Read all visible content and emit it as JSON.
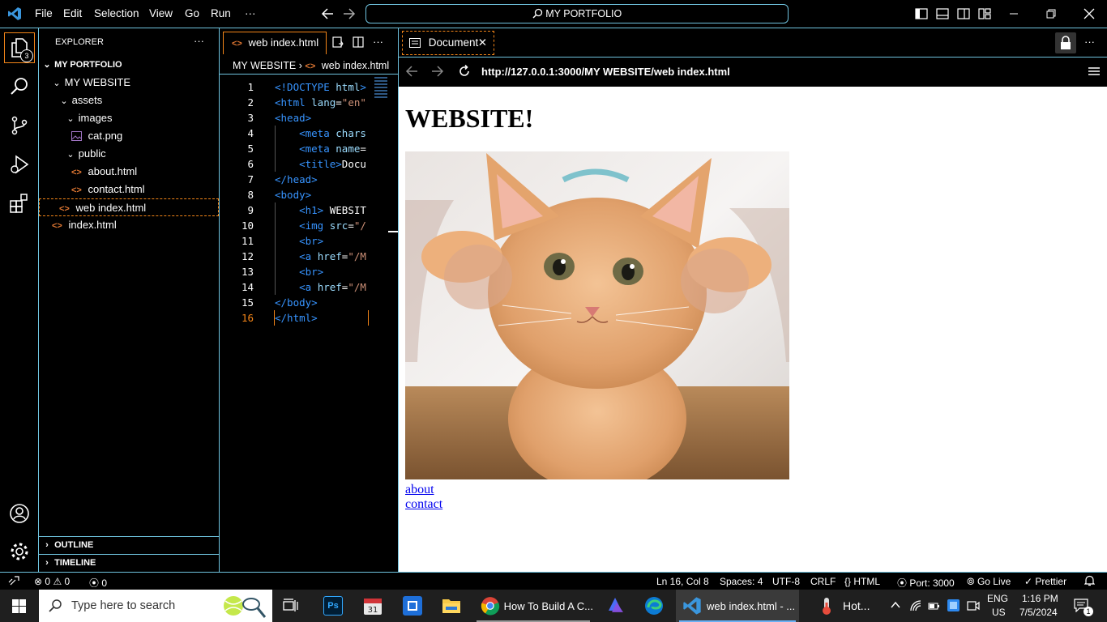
{
  "titlebar": {
    "menu": [
      "File",
      "Edit",
      "Selection",
      "View",
      "Go",
      "Run",
      "···"
    ],
    "command_center": "MY PORTFOLIO"
  },
  "activity": {
    "explorer_badge": "3"
  },
  "explorer": {
    "title": "EXPLORER",
    "more": "···",
    "root": "MY PORTFOLIO",
    "tree": [
      {
        "label": "MY WEBSITE",
        "type": "folder"
      },
      {
        "label": "assets",
        "type": "folder"
      },
      {
        "label": "images",
        "type": "folder"
      },
      {
        "label": "cat.png",
        "type": "image"
      },
      {
        "label": "public",
        "type": "folder"
      },
      {
        "label": "about.html",
        "type": "html"
      },
      {
        "label": "contact.html",
        "type": "html"
      },
      {
        "label": "web index.html",
        "type": "html"
      },
      {
        "label": "index.html",
        "type": "html"
      }
    ],
    "outline": "OUTLINE",
    "timeline": "TIMELINE"
  },
  "editor": {
    "tab_label": "web index.html",
    "more": "···",
    "breadcrumb": [
      "MY WEBSITE",
      "web index.html"
    ],
    "line_numbers": [
      "1",
      "2",
      "3",
      "4",
      "5",
      "6",
      "7",
      "8",
      "9",
      "10",
      "11",
      "12",
      "13",
      "14",
      "15",
      "16"
    ],
    "lines": [
      [
        [
          "tag",
          "<!DOCTYPE "
        ],
        [
          "attr",
          "html"
        ],
        [
          "tag",
          ">"
        ]
      ],
      [
        [
          "tag",
          "<html "
        ],
        [
          "attr",
          "lang"
        ],
        [
          "txtc",
          "="
        ],
        [
          "str",
          "\"en\""
        ]
      ],
      [
        [
          "tag",
          "<head>"
        ]
      ],
      [
        [
          "txtc",
          "    "
        ],
        [
          "tag",
          "<meta "
        ],
        [
          "attr",
          "chars"
        ]
      ],
      [
        [
          "txtc",
          "    "
        ],
        [
          "tag",
          "<meta "
        ],
        [
          "attr",
          "name"
        ],
        [
          "txtc",
          "="
        ]
      ],
      [
        [
          "txtc",
          "    "
        ],
        [
          "tag",
          "<title>"
        ],
        [
          "txtc",
          "Docu"
        ]
      ],
      [
        [
          "tag",
          "</head>"
        ]
      ],
      [
        [
          "tag",
          "<body>"
        ]
      ],
      [
        [
          "txtc",
          "    "
        ],
        [
          "tag",
          "<h1>"
        ],
        [
          "txtc",
          " WEBSIT"
        ]
      ],
      [
        [
          "txtc",
          "    "
        ],
        [
          "tag",
          "<img "
        ],
        [
          "attr",
          "src"
        ],
        [
          "txtc",
          "="
        ],
        [
          "str",
          "\"/"
        ]
      ],
      [
        [
          "txtc",
          "    "
        ],
        [
          "tag",
          "<br>"
        ]
      ],
      [
        [
          "txtc",
          "    "
        ],
        [
          "tag",
          "<a "
        ],
        [
          "attr",
          "href"
        ],
        [
          "txtc",
          "="
        ],
        [
          "str",
          "\"/M"
        ]
      ],
      [
        [
          "txtc",
          "    "
        ],
        [
          "tag",
          "<br>"
        ]
      ],
      [
        [
          "txtc",
          "    "
        ],
        [
          "tag",
          "<a "
        ],
        [
          "attr",
          "href"
        ],
        [
          "txtc",
          "="
        ],
        [
          "str",
          "\"/M"
        ]
      ],
      [
        [
          "tag",
          "</body>"
        ]
      ],
      [
        [
          "tag",
          "</html>"
        ]
      ]
    ]
  },
  "preview": {
    "tab_label": "Document",
    "url": "http://127.0.0.1:3000/MY WEBSITE/web index.html",
    "heading": "WEBSITE!",
    "links": [
      "about",
      "contact"
    ]
  },
  "statusbar": {
    "errors": "0",
    "warnings": "0",
    "ports": "0",
    "position": "Ln 16, Col 8",
    "spaces": "Spaces: 4",
    "encoding": "UTF-8",
    "eol": "CRLF",
    "language": "HTML",
    "port": "Port: 3000",
    "golive": "Go Live",
    "prettier": "Prettier"
  },
  "taskbar": {
    "search_placeholder": "Type here to search",
    "chrome_label": "How To Build A C...",
    "vscode_label": "web index.html - ...",
    "weather": "Hot...",
    "lang1": "ENG",
    "lang2": "US",
    "time": "1:16 PM",
    "date": "7/5/2024",
    "notif_count": "1"
  }
}
